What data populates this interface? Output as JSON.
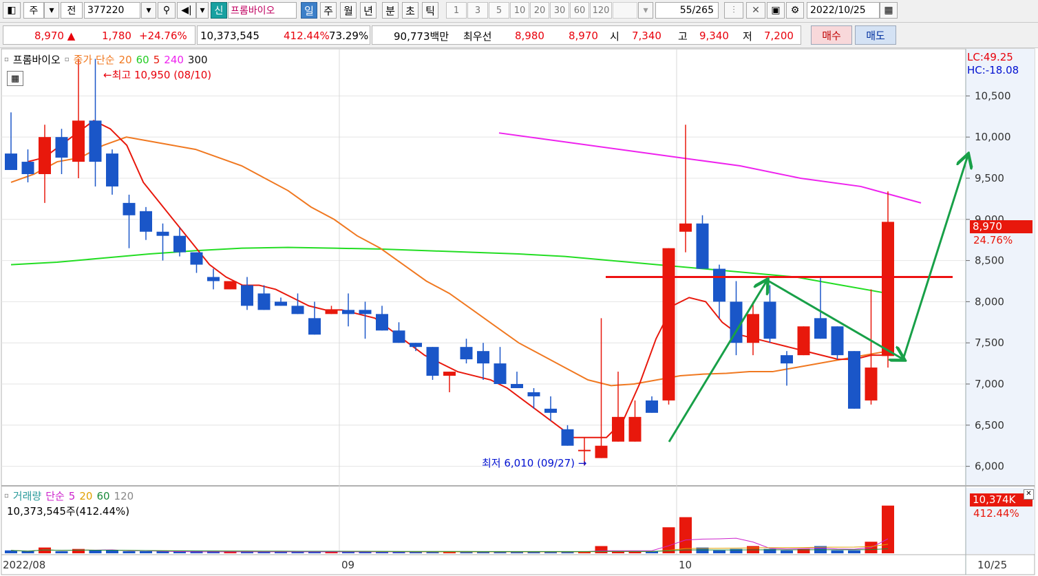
{
  "toolbar": {
    "market_type": "주",
    "market_prefix": "전",
    "stock_code": "377220",
    "credit_badge": "신",
    "stock_name": "프롬바이오",
    "periods": [
      "일",
      "주",
      "월",
      "년",
      "분",
      "초",
      "틱"
    ],
    "active_period": "일",
    "intervals": [
      "1",
      "3",
      "5",
      "10",
      "20",
      "30",
      "60",
      "120"
    ],
    "page_counter": "55/265",
    "date": "2022/10/25"
  },
  "quote": {
    "price": "8,970",
    "change_arrow": "▲",
    "change": "1,780",
    "change_pct": "+24.76%",
    "volume": "10,373,545",
    "volume_ratio": "412.44%",
    "turnover": "73.29%",
    "trade_value": "90,773백만",
    "best_label": "최우선",
    "best_ask": "8,980",
    "best_bid": "8,970",
    "open_label": "시",
    "open": "7,340",
    "high_label": "고",
    "high": "9,340",
    "low_label": "저",
    "low": "7,200",
    "buy_label": "매수",
    "sell_label": "매도"
  },
  "price_panel": {
    "legend_name": "프롬바이오",
    "legend_ma_title": "종가 단순",
    "ma_periods": [
      "20",
      "60",
      "5",
      "240",
      "300"
    ],
    "lc_label": "LC:49.25",
    "hc_label": "HC:-18.08",
    "high_annotation": "최고 10,950 (08/10)",
    "low_annotation": "최저 6,010 (09/27)",
    "current_price_tag": "8,970",
    "current_pct_tag": "24.76%"
  },
  "volume_panel": {
    "legend_title": "거래량",
    "legend_ma_title": "단순",
    "ma_periods": [
      "5",
      "20",
      "60",
      "120"
    ],
    "volume_text": "10,373,545주(412.44%)",
    "current_volume_tag": "10,374K",
    "current_pct_tag": "412.44%"
  },
  "x_axis": {
    "labels": [
      "2022/08",
      "09",
      "10"
    ],
    "right_label": "10/25"
  },
  "colors": {
    "up": "#e8180c",
    "down": "#1a56c8",
    "ma5": "#e8180c",
    "ma20": "#f07820",
    "ma60": "#22dd22",
    "ma240": "#ee22ee",
    "annotation_green": "#18a048"
  },
  "chart_data": {
    "type": "candlestick",
    "y_ticks": [
      10500,
      10000,
      9500,
      9000,
      8500,
      8000,
      7500,
      7000,
      6500,
      6000
    ],
    "ylim": [
      5980,
      11080
    ],
    "candles": [
      {
        "o": 9800,
        "h": 10300,
        "l": 9600,
        "c": 9600
      },
      {
        "o": 9700,
        "h": 9850,
        "l": 9450,
        "c": 9550
      },
      {
        "o": 9550,
        "h": 10150,
        "l": 9200,
        "c": 10000
      },
      {
        "o": 10000,
        "h": 10100,
        "l": 9550,
        "c": 9750
      },
      {
        "o": 9700,
        "h": 10950,
        "l": 9500,
        "c": 10200
      },
      {
        "o": 10200,
        "h": 10950,
        "l": 9400,
        "c": 9700
      },
      {
        "o": 9800,
        "h": 9850,
        "l": 9300,
        "c": 9400
      },
      {
        "o": 9200,
        "h": 9300,
        "l": 8650,
        "c": 9050
      },
      {
        "o": 9100,
        "h": 9150,
        "l": 8750,
        "c": 8850
      },
      {
        "o": 8850,
        "h": 8950,
        "l": 8500,
        "c": 8800
      },
      {
        "o": 8800,
        "h": 8900,
        "l": 8550,
        "c": 8600
      },
      {
        "o": 8600,
        "h": 8550,
        "l": 8350,
        "c": 8450
      },
      {
        "o": 8300,
        "h": 8400,
        "l": 8150,
        "c": 8250
      },
      {
        "o": 8150,
        "h": 8250,
        "l": 8150,
        "c": 8250
      },
      {
        "o": 8200,
        "h": 8300,
        "l": 7900,
        "c": 7950
      },
      {
        "o": 8100,
        "h": 8200,
        "l": 7950,
        "c": 7900
      },
      {
        "o": 8000,
        "h": 8050,
        "l": 7950,
        "c": 7950
      },
      {
        "o": 7950,
        "h": 8100,
        "l": 7850,
        "c": 7850
      },
      {
        "o": 7800,
        "h": 8000,
        "l": 7700,
        "c": 7600
      },
      {
        "o": 7850,
        "h": 7950,
        "l": 7850,
        "c": 7900
      },
      {
        "o": 7900,
        "h": 8100,
        "l": 7700,
        "c": 7850
      },
      {
        "o": 7900,
        "h": 8000,
        "l": 7550,
        "c": 7850
      },
      {
        "o": 7850,
        "h": 7950,
        "l": 7650,
        "c": 7650
      },
      {
        "o": 7650,
        "h": 7750,
        "l": 7500,
        "c": 7500
      },
      {
        "o": 7500,
        "h": 7500,
        "l": 7400,
        "c": 7450
      },
      {
        "o": 7450,
        "h": 7450,
        "l": 7050,
        "c": 7100
      },
      {
        "o": 7100,
        "h": 7150,
        "l": 6900,
        "c": 7150
      },
      {
        "o": 7450,
        "h": 7550,
        "l": 7250,
        "c": 7300
      },
      {
        "o": 7400,
        "h": 7500,
        "l": 7050,
        "c": 7250
      },
      {
        "o": 7250,
        "h": 7450,
        "l": 7100,
        "c": 7000
      },
      {
        "o": 7000,
        "h": 7150,
        "l": 6950,
        "c": 6950
      },
      {
        "o": 6900,
        "h": 6950,
        "l": 6700,
        "c": 6850
      },
      {
        "o": 6700,
        "h": 6850,
        "l": 6550,
        "c": 6650
      },
      {
        "o": 6450,
        "h": 6500,
        "l": 6250,
        "c": 6250
      },
      {
        "o": 6200,
        "h": 6350,
        "l": 6010,
        "c": 6200
      },
      {
        "o": 6100,
        "h": 7800,
        "l": 6100,
        "c": 6250
      },
      {
        "o": 6300,
        "h": 7150,
        "l": 6350,
        "c": 6600
      },
      {
        "o": 6300,
        "h": 6800,
        "l": 6300,
        "c": 6600
      },
      {
        "o": 6800,
        "h": 6850,
        "l": 6650,
        "c": 6650
      },
      {
        "o": 6800,
        "h": 8650,
        "l": 6750,
        "c": 8650
      },
      {
        "o": 8850,
        "h": 10150,
        "l": 8600,
        "c": 8950
      },
      {
        "o": 8950,
        "h": 9050,
        "l": 8400,
        "c": 8400
      },
      {
        "o": 8400,
        "h": 8450,
        "l": 7800,
        "c": 8000
      },
      {
        "o": 8000,
        "h": 8250,
        "l": 7350,
        "c": 7500
      },
      {
        "o": 7500,
        "h": 8000,
        "l": 7350,
        "c": 7850
      },
      {
        "o": 8000,
        "h": 8200,
        "l": 7500,
        "c": 7550
      },
      {
        "o": 7350,
        "h": 7400,
        "l": 6980,
        "c": 7250
      },
      {
        "o": 7350,
        "h": 7700,
        "l": 7350,
        "c": 7700
      },
      {
        "o": 7800,
        "h": 8300,
        "l": 7650,
        "c": 7550
      },
      {
        "o": 7700,
        "h": 7700,
        "l": 7300,
        "c": 7350
      },
      {
        "o": 7400,
        "h": 7400,
        "l": 6700,
        "c": 6700
      },
      {
        "o": 6800,
        "h": 8150,
        "l": 6750,
        "c": 7200
      },
      {
        "o": 7340,
        "h": 9340,
        "l": 7200,
        "c": 8970
      }
    ],
    "ma5": [
      9700,
      9750,
      9900,
      10050,
      10200,
      10100,
      9900,
      9450,
      9200,
      8950,
      8700,
      8450,
      8300,
      8200,
      8200,
      8150,
      8050,
      7950,
      7900,
      7900,
      7850,
      7800,
      7650,
      7500,
      7350,
      7250,
      7150,
      7100,
      7050,
      6950,
      6800,
      6650,
      6500,
      6350,
      6350,
      6350,
      6550,
      7000,
      7550,
      7950,
      8050,
      8000,
      7750,
      7600,
      7550,
      7500,
      7450,
      7400,
      7350,
      7300,
      7300,
      7350,
      7350
    ],
    "ma20": [
      9450,
      9550,
      9700,
      9750,
      9900,
      10000,
      9950,
      9900,
      9850,
      9750,
      9650,
      9500,
      9350,
      9150,
      9000,
      8800,
      8650,
      8450,
      8250,
      8100,
      7900,
      7700,
      7500,
      7350,
      7200,
      7050,
      6980,
      7000,
      7050,
      7100,
      7120,
      7130,
      7150,
      7150,
      7200,
      7250,
      7300,
      7350,
      7400
    ],
    "ma60": [
      8450,
      8480,
      8530,
      8580,
      8620,
      8650,
      8660,
      8650,
      8640,
      8620,
      8600,
      8580,
      8550,
      8500,
      8450,
      8400,
      8350,
      8300,
      8200,
      8100
    ],
    "ma240": [
      10050,
      9950,
      9850,
      9750,
      9650,
      9500,
      9400,
      9200
    ],
    "volumes": [
      2,
      1,
      4,
      1,
      3,
      2,
      2,
      1,
      1,
      1,
      1,
      1,
      1,
      1,
      1,
      1,
      1,
      1,
      1,
      1,
      1,
      1,
      1,
      1,
      1,
      1,
      1,
      1,
      1,
      1,
      1,
      1,
      1,
      1,
      1,
      5,
      1,
      1,
      1,
      18,
      25,
      4,
      2,
      3,
      5,
      3,
      2,
      3,
      5,
      2,
      2,
      8,
      33
    ],
    "horizontal_line": 8300
  }
}
